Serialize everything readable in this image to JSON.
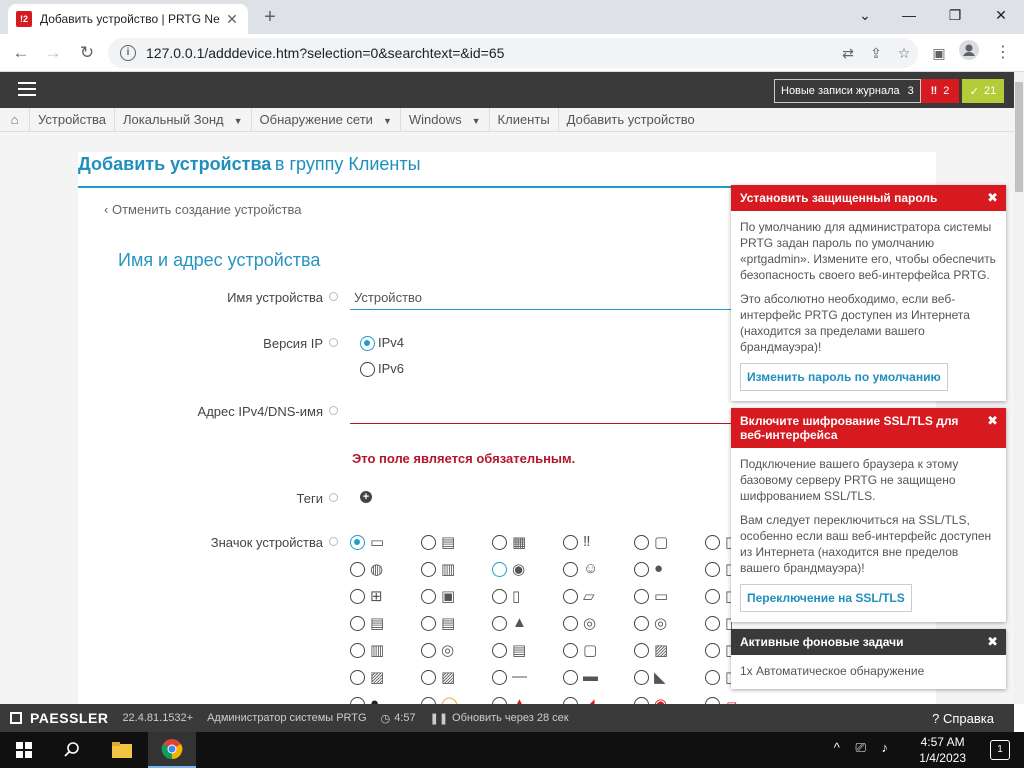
{
  "browser": {
    "tab_title": "Добавить устройство | PRTG Ne",
    "url": "127.0.0.1/adddevice.htm?selection=0&searchtext=&id=65",
    "favicon_text": "!2"
  },
  "header": {
    "log_label": "Новые записи журнала",
    "log_count": "3",
    "alarm_count": "2",
    "ok_count": "21"
  },
  "breadcrumbs": [
    {
      "label": "Устройства"
    },
    {
      "label": "Локальный Зонд"
    },
    {
      "label": "Обнаружение сети"
    },
    {
      "label": "Windows"
    },
    {
      "label": "Клиенты"
    },
    {
      "label": "Добавить устройство"
    }
  ],
  "form": {
    "title_bold": "Добавить устройства",
    "title_rest": "в группу Клиенты",
    "cancel": "Отменить создание устройства",
    "section": "Имя и адрес устройства",
    "device_name_label": "Имя устройства",
    "device_name_value": "Устройство",
    "ip_version_label": "Версия IP",
    "ipv4": "IPv4",
    "ipv6": "IPv6",
    "address_label": "Адрес IPv4/DNS-имя",
    "address_value": "",
    "required_error": "Это поле является обязательным.",
    "tags_label": "Теги",
    "icon_label": "Значок устройства"
  },
  "notifications": [
    {
      "title": "Установить защищенный пароль",
      "paragraphs": [
        "По умолчанию для администратора системы PRTG задан пароль по умолчанию «prtgadmin». Измените его, чтобы обеспечить безопасность своего веб-интерфейса PRTG.",
        "Это абсолютно необходимо, если веб-интерфейс PRTG доступен из Интернета (находится за пределами вашего брандмауэра)!"
      ],
      "button": "Изменить пароль по умолчанию"
    },
    {
      "title": "Включите шифрование SSL/TLS для веб-интерфейса",
      "paragraphs": [
        "Подключение вашего браузера к этому базовому серверу PRTG не защищено шифрованием SSL/TLS.",
        "Вам следует переключиться на SSL/TLS, особенно если ваш веб-интерфейс доступен из Интернета (находится вне пределов вашего брандмауэра)!"
      ],
      "button": "Переключение на SSL/TLS"
    },
    {
      "title": "Активные фоновые задачи",
      "paragraphs": [
        "1x Автоматическое обнаружение"
      ]
    }
  ],
  "footer": {
    "brand": "PAESSLER",
    "version": "22.4.81.1532+",
    "user": "Администратор системы PRTG",
    "time": "4:57",
    "refresh": "Обновить через 28 сек",
    "help": "Справка"
  },
  "taskbar": {
    "time": "4:57 AM",
    "date": "1/4/2023",
    "notif_count": "1"
  },
  "colors": {
    "accent": "#1f9cc9",
    "alarm": "#d71920",
    "ok": "#b4cc38",
    "dark": "#3a3a3a"
  }
}
